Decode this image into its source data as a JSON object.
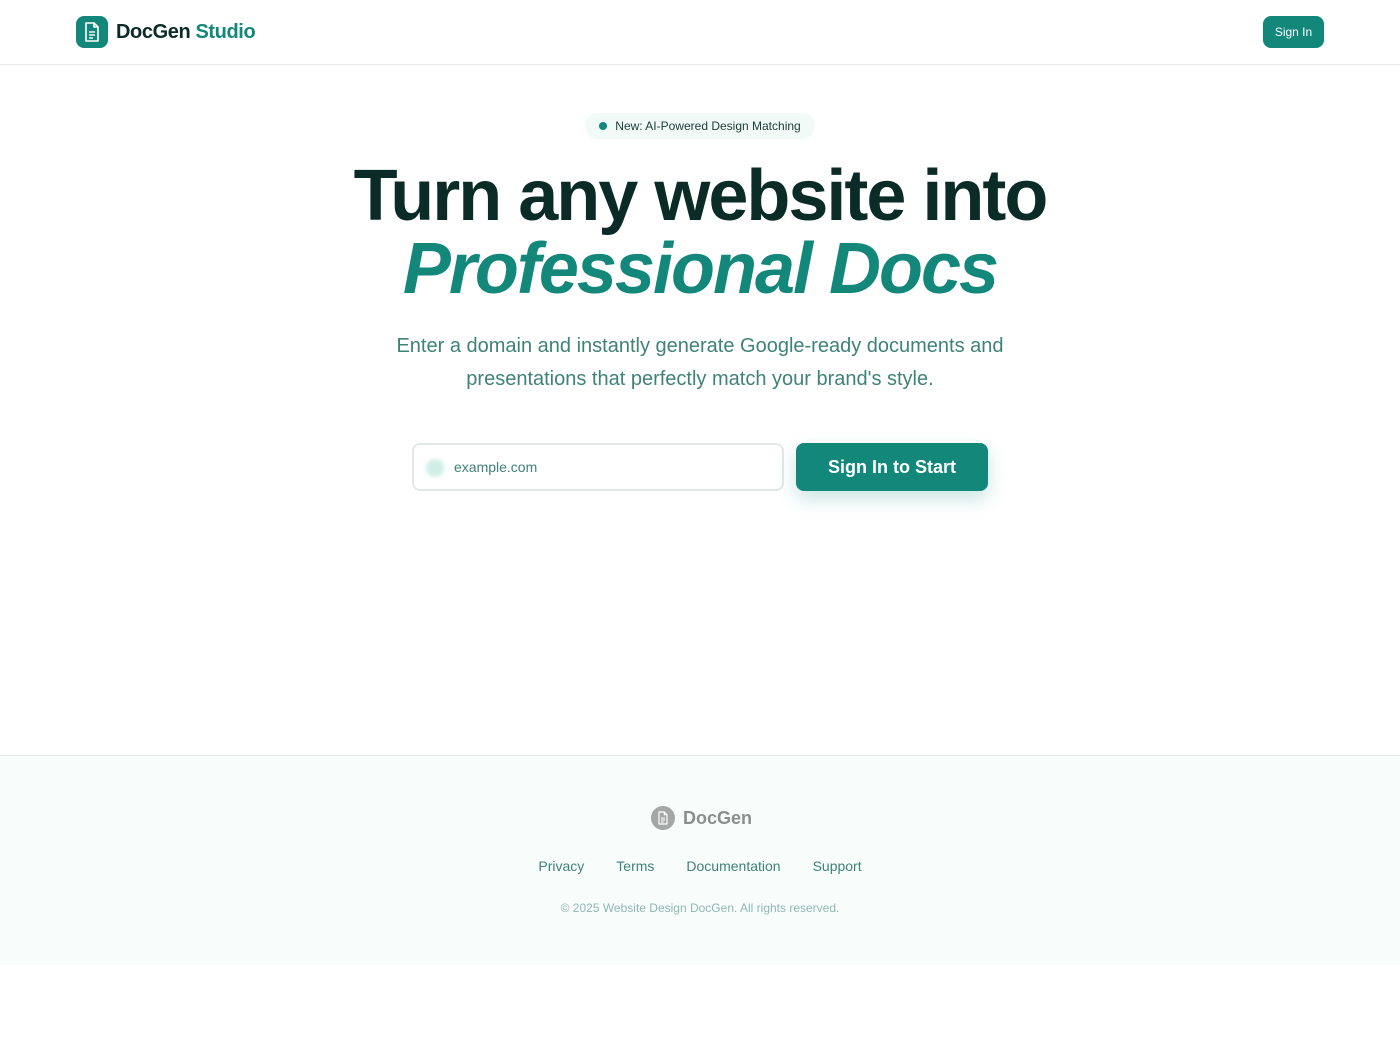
{
  "header": {
    "brand_primary": "DocGen",
    "brand_accent": "Studio",
    "logo_icon": "document-icon",
    "signin_label": "Sign In"
  },
  "hero": {
    "badge": "New: AI-Powered Design Matching",
    "headline": "Turn any website into",
    "headline_accent": "Professional Docs",
    "subtitle": "Enter a domain and instantly generate Google-ready documents and presentations that perfectly match your brand's style."
  },
  "form": {
    "domain_placeholder": "example.com",
    "domain_value": "",
    "start_label": "Sign In to Start"
  },
  "footer": {
    "brand": "DocGen",
    "logo_icon": "document-icon",
    "links": [
      "Privacy",
      "Terms",
      "Documentation",
      "Support"
    ],
    "copyright": "© 2025 Website Design DocGen. All rights reserved."
  },
  "colors": {
    "brand": "#13877a",
    "heading": "#0b2b27",
    "muted_text": "#3f8278",
    "footer_bg": "#f8fcfb"
  }
}
